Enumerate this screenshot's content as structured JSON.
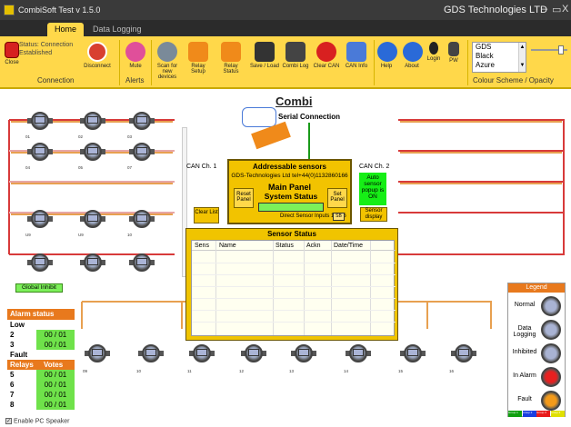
{
  "window": {
    "title": "CombiSoft Test v 1.5.0",
    "company": "GDS Technologies LTD",
    "minimize": "–",
    "restore": "▭",
    "close": "X"
  },
  "tabs": [
    {
      "label": "Home"
    },
    {
      "label": "Data Logging"
    }
  ],
  "ribbon": {
    "close_label": "Close",
    "status_text": "Status: Connection Established",
    "disconnect_label": "Disconnect",
    "connection_group": "Connection",
    "mute_label": "Mute",
    "alerts_group": "Alerts",
    "scan_label": "Scan for new devices",
    "relay_setup_label": "Relay Setup",
    "relay_status_label": "Relay Status",
    "save_load_label": "Save / Load",
    "combi_log_label": "Combi Log",
    "clear_can_label": "Clear CAN",
    "can_info_label": "CAN Info",
    "help_label": "Help",
    "about_label": "About",
    "login_label": "Login",
    "pw_label": "PW",
    "scheme_options": [
      "GDS",
      "Black",
      "Azure"
    ],
    "scheme_group": "Colour Scheme / Opacity",
    "opacity_value": 0.8
  },
  "main": {
    "combi_title": "Combi",
    "serial_label": "Serial Connection",
    "can1": "CAN Ch. 1",
    "can2": "CAN Ch. 2",
    "auto_popup": "Auto sensor popup is ON",
    "sensor_display_btn": "Sensor display",
    "clear_list_btn": "Clear List",
    "global_inhibit": "Global Inhibit"
  },
  "panel": {
    "title": "Addressable sensors",
    "contact": "GDS-Technologies Ltd tel+44(0)1132860166",
    "main_panel": "Main Panel",
    "system_status": "System Status",
    "reset_panel": "Reset Panel",
    "set_panel": "Set Panel",
    "direct_inputs": "Direct Sensor Inputs 1....16",
    "sb_label": "SB"
  },
  "sensor_status": {
    "title": "Sensor Status",
    "columns": [
      "Sens",
      "Name",
      "Status",
      "Ackn",
      "Date/Time"
    ]
  },
  "top_sensors": [
    {
      "label": "01"
    },
    {
      "label": "02"
    },
    {
      "label": "03"
    },
    {
      "label": "04"
    },
    {
      "label": "05"
    },
    {
      "label": "07"
    },
    {
      "label": "U9"
    },
    {
      "label": "U9"
    },
    {
      "label": "10"
    },
    {
      "label": ""
    },
    {
      "label": ""
    },
    {
      "label": ""
    }
  ],
  "bottom_sensors": [
    {
      "label": "09"
    },
    {
      "label": "10"
    },
    {
      "label": "11"
    },
    {
      "label": "12"
    },
    {
      "label": "13"
    },
    {
      "label": "14"
    },
    {
      "label": "15"
    },
    {
      "label": "16"
    }
  ],
  "alarm_status": {
    "title": "Alarm status",
    "low_label": "Low",
    "rows_low": [
      {
        "k": "2",
        "v": "00 /  01"
      },
      {
        "k": "3",
        "v": "00 /  01"
      }
    ],
    "fault_label": "Fault",
    "relays_label": "Relays",
    "votes_label": "Votes",
    "rows_relays": [
      {
        "k": "5",
        "v": "00 /  01"
      },
      {
        "k": "6",
        "v": "00 /  01"
      },
      {
        "k": "7",
        "v": "00 /  01"
      },
      {
        "k": "8",
        "v": "00 /  01"
      }
    ]
  },
  "pc_speaker": {
    "label": "Enable PC Speaker",
    "checked": true
  },
  "legend": {
    "title": "Legend",
    "items": [
      {
        "label": "Normal",
        "color": "#a9b3d3"
      },
      {
        "label": "Data Logging",
        "color": "#a9b3d3"
      },
      {
        "label": "Inhibited",
        "color": "#a9b3d3"
      },
      {
        "label": "In Alarm",
        "color": "#e82020"
      },
      {
        "label": "Fault",
        "color": "#f39a1a"
      }
    ],
    "groups": [
      "Group 1",
      "Group 2",
      "Group 3",
      "Group 4"
    ],
    "group_colors": [
      "#10a010",
      "#1a3ee0",
      "#e81a1a",
      "#e0e000"
    ]
  },
  "colors": {
    "accent": "#ffd84a",
    "orange": "#e8791d",
    "green": "#6fe24a",
    "wire": "#d83a3a"
  }
}
